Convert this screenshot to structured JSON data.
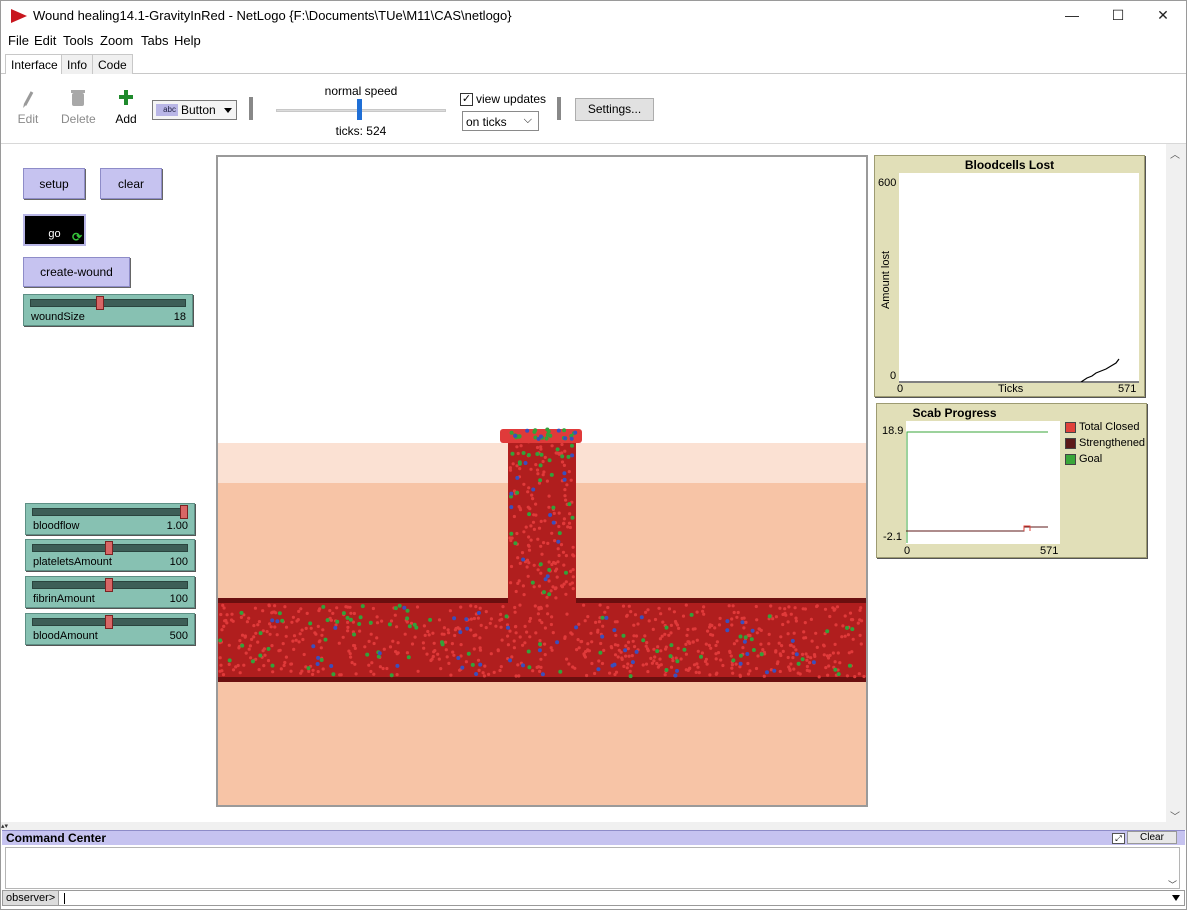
{
  "window": {
    "title": "Wound healing14.1-GravityInRed - NetLogo {F:\\Documents\\TUe\\M11\\CAS\\netlogo}",
    "minimize": "—",
    "maximize": "☐",
    "close": "✕"
  },
  "menu": [
    "File",
    "Edit",
    "Tools",
    "Zoom",
    "Tabs",
    "Help"
  ],
  "tabs": [
    "Interface",
    "Info",
    "Code"
  ],
  "active_tab": "Interface",
  "toolbar": {
    "edit_label": "Edit",
    "delete_label": "Delete",
    "add_label": "Add",
    "widget_badge": "abc",
    "widget_type": "Button",
    "speed_label": "normal speed",
    "speed_fraction": 0.5,
    "ticks_text": "ticks: 524",
    "view_updates_label": "view updates",
    "view_updates_checked": "✓",
    "update_mode": "on ticks",
    "settings_label": "Settings..."
  },
  "buttons": {
    "setup": "setup",
    "clear": "clear",
    "go": "go",
    "create_wound": "create-wound"
  },
  "sliders": [
    {
      "name": "woundSize",
      "value": "18",
      "fraction": 0.45
    },
    {
      "name": "bloodflow",
      "value": "1.00",
      "fraction": 1.0
    },
    {
      "name": "plateletsAmount",
      "value": "100",
      "fraction": 0.5
    },
    {
      "name": "fibrinAmount",
      "value": "100",
      "fraction": 0.5
    },
    {
      "name": "bloodAmount",
      "value": "500",
      "fraction": 0.5
    }
  ],
  "plots": {
    "bloodcells": {
      "title": "Bloodcells Lost",
      "ylabel": "Amount lost",
      "xlabel": "Ticks",
      "ymax": "600",
      "ymin": "0",
      "xmin": "0",
      "xmax": "571"
    },
    "scab": {
      "title": "Scab Progress",
      "ymax": "18.9",
      "ymin": "-2.1",
      "xmin": "0",
      "xmax": "571",
      "legend": [
        {
          "label": "Total Closed",
          "color": "#e0413a"
        },
        {
          "label": "Strengthened",
          "color": "#5c1a1a"
        },
        {
          "label": "Goal",
          "color": "#3aa63a"
        }
      ]
    }
  },
  "colors": {
    "skin_light": "#fbe1d3",
    "skin": "#f7c4a6",
    "blood": "#b01e1e",
    "vessel_edge": "#6b0f0f",
    "platelet": "#33a23a",
    "fibrin": "#3b4fbd",
    "cell": "#e03a3a"
  },
  "command_center": {
    "title": "Command Center",
    "clear_label": "Clear",
    "agent": "observer>"
  }
}
